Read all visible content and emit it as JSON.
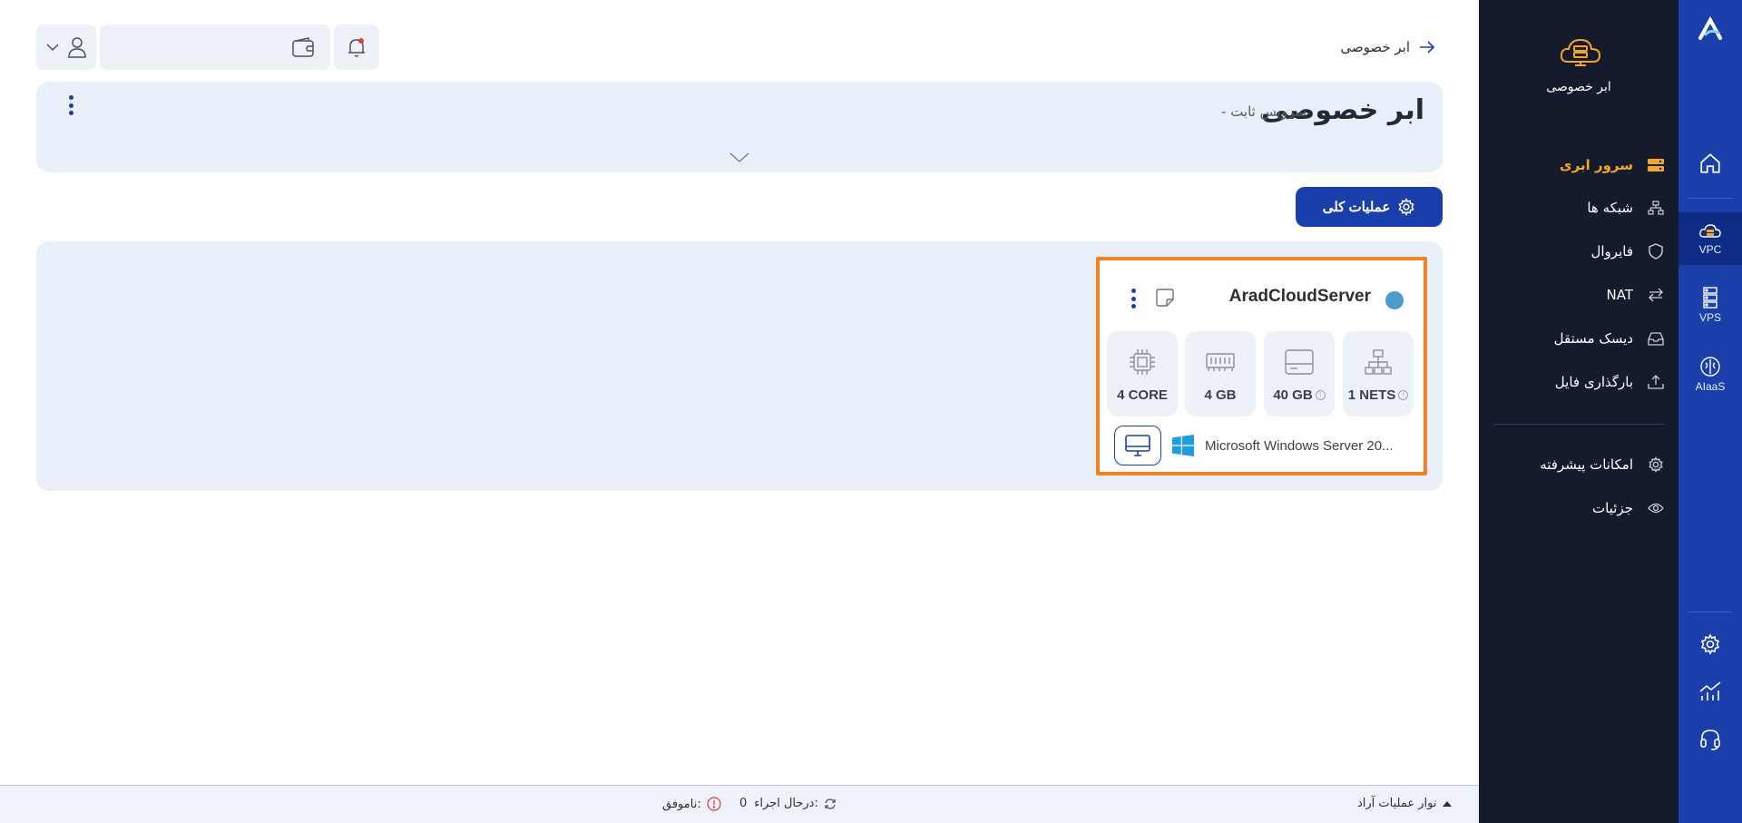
{
  "colors": {
    "brand": "#1b3faa",
    "sidebar": "#141b2d",
    "accent": "#f5a623",
    "highlight": "#f5821f",
    "status": "#4a9ccf"
  },
  "rail": {
    "items": [
      {
        "icon": "home-icon",
        "label": ""
      },
      {
        "icon": "cloud-server-icon",
        "label": "VPC"
      },
      {
        "icon": "server-rack-icon",
        "label": "VPS"
      },
      {
        "icon": "ai-brain-icon",
        "label": "AIaaS"
      },
      {
        "icon": "gear-icon",
        "label": ""
      },
      {
        "icon": "chart-icon",
        "label": ""
      },
      {
        "icon": "headset-icon",
        "label": ""
      }
    ]
  },
  "sidebar": {
    "title": "ابر خصوصی",
    "items": [
      {
        "label": "سرور ابری",
        "icon": "server-icon",
        "active": true
      },
      {
        "label": "شبکه ها",
        "icon": "network-icon"
      },
      {
        "label": "فایروال",
        "icon": "shield-icon"
      },
      {
        "label": "NAT",
        "icon": "arrows-icon"
      },
      {
        "label": "دیسک مستقل",
        "icon": "disk-icon"
      },
      {
        "label": "بارگذاری فایل",
        "icon": "upload-icon"
      },
      {
        "label": "امکانات پیشرفته",
        "icon": "gear-icon"
      },
      {
        "label": "جزئیات",
        "icon": "eye-icon"
      }
    ]
  },
  "breadcrumb": {
    "label": "ابر خصوصی"
  },
  "header": {
    "title": "ابر خصوصی",
    "subtitle": "- سرویس ثابت"
  },
  "toolbar": {
    "ops_label": "عملیات کلی",
    "wallet_value": ""
  },
  "server": {
    "name": "AradCloudServer",
    "specs": [
      {
        "value": "1 NETS",
        "icon": "network-icon",
        "info": true
      },
      {
        "value": "40 GB",
        "icon": "disk-icon",
        "info": true
      },
      {
        "value": "4 GB",
        "icon": "ram-icon",
        "info": false
      },
      {
        "value": "4 CORE",
        "icon": "cpu-icon",
        "info": false
      }
    ],
    "os": "Microsoft Windows Server 20..."
  },
  "bottombar": {
    "ops_label": "نوار عملیات آراد",
    "running_label": "درحال اجراء:",
    "running_count": "0",
    "failed_label": "ناموفق:"
  }
}
